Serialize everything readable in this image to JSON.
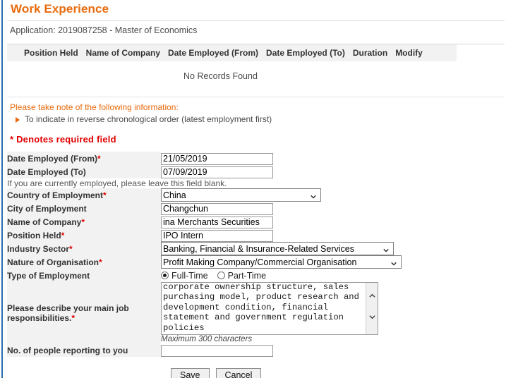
{
  "page": {
    "title": "Work Experience",
    "application_line": "Application: 2019087258 - Master of Economics",
    "accent_color": "#e8690b",
    "required_color": "#e00000",
    "rail_color": "#2b6cb0",
    "label_bg": "#f2f2f2"
  },
  "records_table": {
    "columns": [
      "Position Held",
      "Name of Company",
      "Date Employed (From)",
      "Date Employed (To)",
      "Duration",
      "Modify"
    ],
    "empty_message": "No Records Found"
  },
  "notes": {
    "heading": "Please take note of the following information:",
    "items": [
      "To indicate in reverse chronological order (latest employment first)"
    ],
    "bullet_icon": "triangle-right-icon",
    "required_legend": "* Denotes required field"
  },
  "form": {
    "date_from": {
      "label": "Date Employed (From)",
      "required_mark": "*",
      "value": "21/05/2019",
      "placeholder": ""
    },
    "date_to": {
      "label": "Date Employed (To)",
      "required_mark": "",
      "value": "07/09/2019",
      "placeholder": "",
      "hint": "If you are currently employed, please leave this field blank."
    },
    "country": {
      "label": "Country of Employment",
      "required_mark": "*",
      "value": "China",
      "icon": "chevron-down-icon"
    },
    "city": {
      "label": "City of Employment",
      "required_mark": "",
      "value": "Changchun",
      "placeholder": ""
    },
    "company": {
      "label": "Name of Company",
      "required_mark": "*",
      "value": "ina Merchants Securities",
      "placeholder": ""
    },
    "position": {
      "label": "Position Held",
      "required_mark": "*",
      "value": "IPO Intern",
      "placeholder": ""
    },
    "industry": {
      "label": "Industry Sector",
      "required_mark": "*",
      "value": "Banking, Financial & Insurance-Related Services",
      "icon": "chevron-down-icon"
    },
    "nature": {
      "label": "Nature of Organisation",
      "required_mark": "*",
      "value": "Profit Making Company/Commercial Organisation",
      "icon": "chevron-down-icon"
    },
    "employment_type": {
      "label": "Type of Employment",
      "required_mark": "",
      "options": [
        "Full-Time",
        "Part-Time"
      ],
      "selected": "Full-Time"
    },
    "responsibilities": {
      "label_line1": "Please describe your main job",
      "label_line2": "responsibilities.",
      "required_mark": "*",
      "value": "list of IPO Projects based on the corporate ownership structure, sales purchasing model, product research and development condition, financial statement and government regulation policies",
      "counter_hint": "Maximum 300 characters",
      "scroll_up_icon": "chevron-up-icon",
      "scroll_down_icon": "chevron-down-icon"
    },
    "reports": {
      "label": "No. of people reporting to you",
      "required_mark": "",
      "value": "",
      "placeholder": ""
    }
  },
  "actions": {
    "save_label": "Save",
    "cancel_label": "Cancel"
  }
}
